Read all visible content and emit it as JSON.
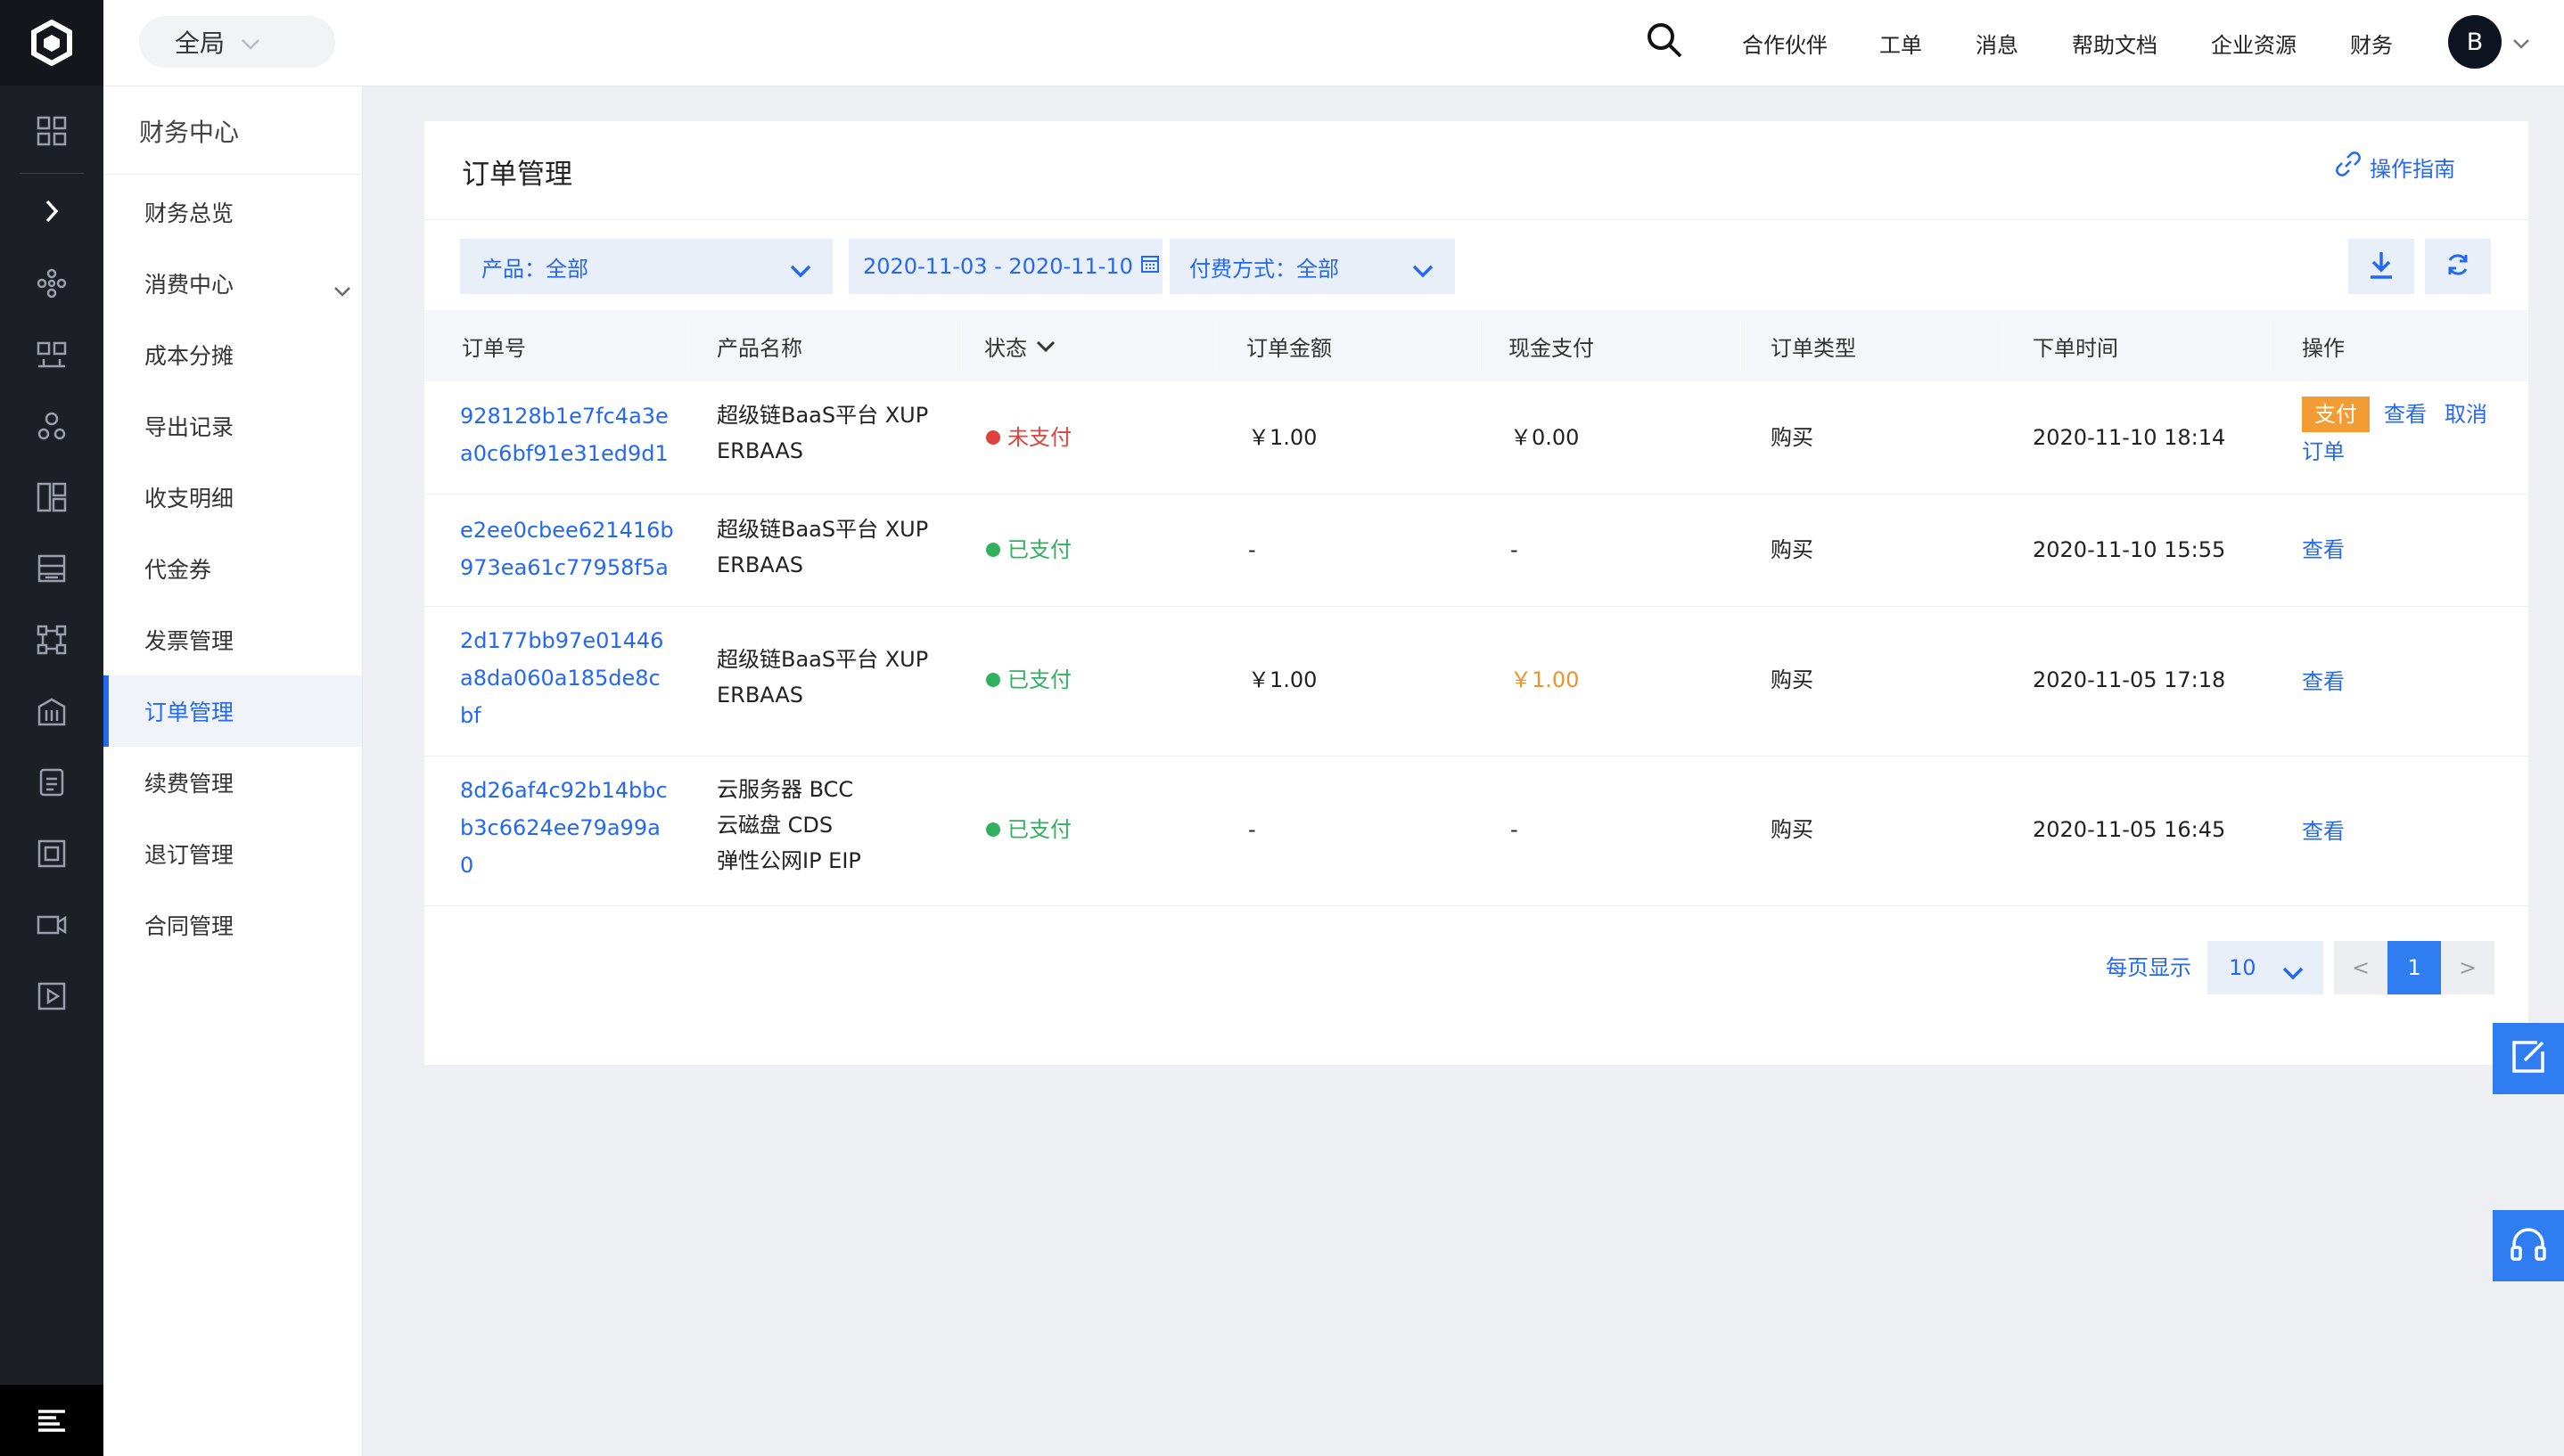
{
  "topbar": {
    "scope_label": "全局",
    "nav": [
      "合作伙伴",
      "工单",
      "消息",
      "帮助文档",
      "企业资源",
      "财务"
    ],
    "avatar_letter": "B"
  },
  "sidebar": {
    "title": "财务中心",
    "items": [
      {
        "label": "财务总览"
      },
      {
        "label": "消费中心"
      },
      {
        "label": "成本分摊"
      },
      {
        "label": "导出记录"
      },
      {
        "label": "收支明细"
      },
      {
        "label": "代金券"
      },
      {
        "label": "发票管理"
      },
      {
        "label": "订单管理"
      },
      {
        "label": "续费管理"
      },
      {
        "label": "退订管理"
      },
      {
        "label": "合同管理"
      }
    ]
  },
  "main": {
    "title": "订单管理",
    "guide_label": "操作指南",
    "filters": {
      "product": "产品：全部",
      "date_range": "2020-11-03 - 2020-11-10",
      "pay_method": "付费方式：全部"
    },
    "columns": [
      "订单号",
      "产品名称",
      "状态",
      "订单金额",
      "现金支付",
      "订单类型",
      "下单时间",
      "操作"
    ],
    "rows": [
      {
        "order_id": [
          "928128b1e7fc4a3e",
          "a0c6bf91e31ed9d1"
        ],
        "product": [
          "超级链BaaS平台 XUP",
          "ERBAAS"
        ],
        "status": "未支付",
        "amount": "￥1.00",
        "cash": "￥0.00",
        "type": "购买",
        "time": "2020-11-10 18:14",
        "actions": {
          "pay": "支付",
          "view": "查看",
          "cancel_1": "取消",
          "cancel_2": "订单"
        }
      },
      {
        "order_id": [
          "e2ee0cbee621416b",
          "973ea61c77958f5a"
        ],
        "product": [
          "超级链BaaS平台 XUP",
          "ERBAAS"
        ],
        "status": "已支付",
        "amount": "-",
        "cash": "-",
        "type": "购买",
        "time": "2020-11-10 15:55",
        "actions": {
          "view": "查看"
        }
      },
      {
        "order_id": [
          "2d177bb97e01446",
          "a8da060a185de8c",
          "bf"
        ],
        "product": [
          "超级链BaaS平台 XUP",
          "ERBAAS"
        ],
        "status": "已支付",
        "amount": "￥1.00",
        "cash": "￥1.00",
        "type": "购买",
        "time": "2020-11-05 17:18",
        "actions": {
          "view": "查看"
        }
      },
      {
        "order_id": [
          "8d26af4c92b14bbc",
          "b3c6624ee79a99a",
          "0"
        ],
        "product": [
          "云服务器 BCC",
          "云磁盘 CDS",
          "弹性公网IP EIP"
        ],
        "status": "已支付",
        "amount": "-",
        "cash": "-",
        "type": "购买",
        "time": "2020-11-05 16:45",
        "actions": {
          "view": "查看"
        }
      }
    ],
    "pagination": {
      "per_page_label": "每页显示",
      "per_page_value": "10",
      "prev": "<",
      "current": "1",
      "next": ">"
    }
  },
  "colors": {
    "accent": "#2468f2",
    "unpaid": "#e0413b",
    "paid": "#31b15e",
    "cash_highlight": "#f0912c",
    "pay_button": "#f39c33",
    "rail_bg": "#1c1f26"
  },
  "icons": [
    "logo-icon",
    "dashboard-icon",
    "expand-icon",
    "nodes-icon",
    "apps-icon",
    "users-icon",
    "grid-icon",
    "storage-icon",
    "network-icon",
    "building-icon",
    "database-icon",
    "frame-icon",
    "video-icon",
    "play-icon",
    "menu-icon",
    "search-icon",
    "link-icon",
    "calendar-icon",
    "download-icon",
    "refresh-icon",
    "edit-icon",
    "headset-icon"
  ]
}
